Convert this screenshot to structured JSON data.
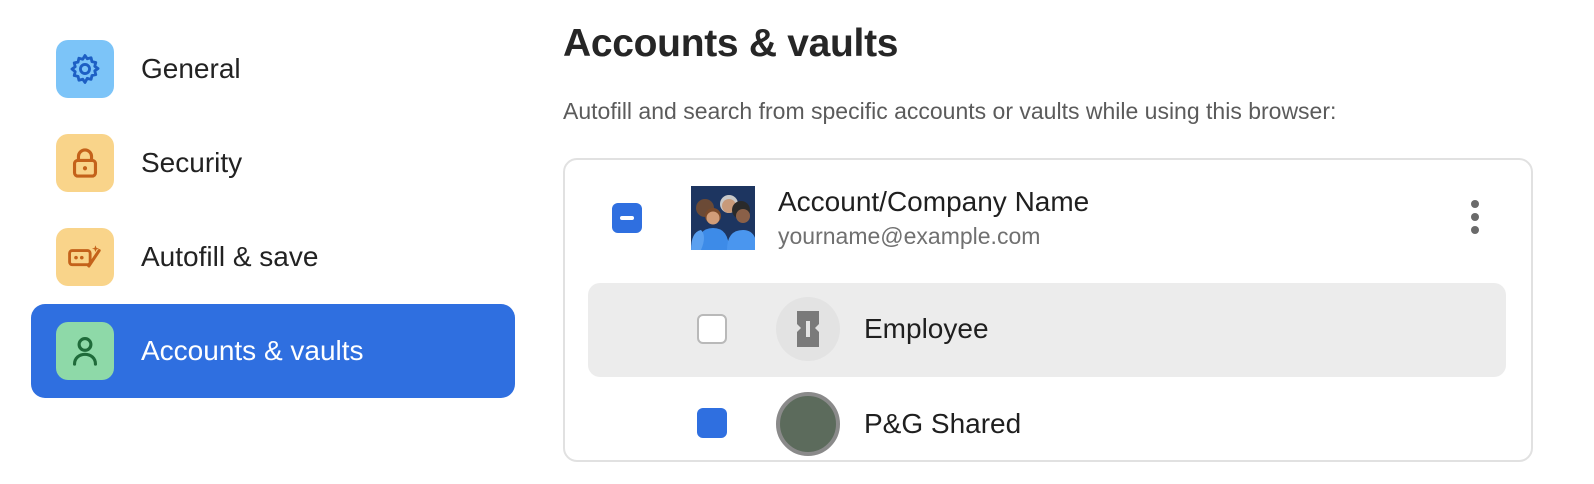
{
  "sidebar": {
    "items": [
      {
        "label": "General",
        "icon": "gear-icon",
        "icon_bg": "#7cc4f8",
        "icon_color": "#1d5fc4"
      },
      {
        "label": "Security",
        "icon": "lock-icon",
        "icon_bg": "#f9d48a",
        "icon_color": "#c4621a"
      },
      {
        "label": "Autofill & save",
        "icon": "autofill-icon",
        "icon_bg": "#f9d48a",
        "icon_color": "#c4621a"
      },
      {
        "label": "Accounts & vaults",
        "icon": "person-icon",
        "icon_bg": "#8ed9a8",
        "icon_color": "#1f6b3a",
        "active": true
      }
    ]
  },
  "main": {
    "title": "Accounts & vaults",
    "subtitle": "Autofill and search from specific accounts or vaults while using this browser:",
    "account": {
      "name": "Account/Company Name",
      "email": "yourname@example.com",
      "checkbox_state": "mixed"
    },
    "vaults": [
      {
        "label": "Employee",
        "checked": false,
        "icon": "vault-icon"
      },
      {
        "label": "P&G Shared",
        "checked": true,
        "icon": "vault-icon"
      }
    ]
  },
  "colors": {
    "accent": "#2f6fe0",
    "row_highlight": "#ececec",
    "card_border": "#e1e1e1"
  }
}
